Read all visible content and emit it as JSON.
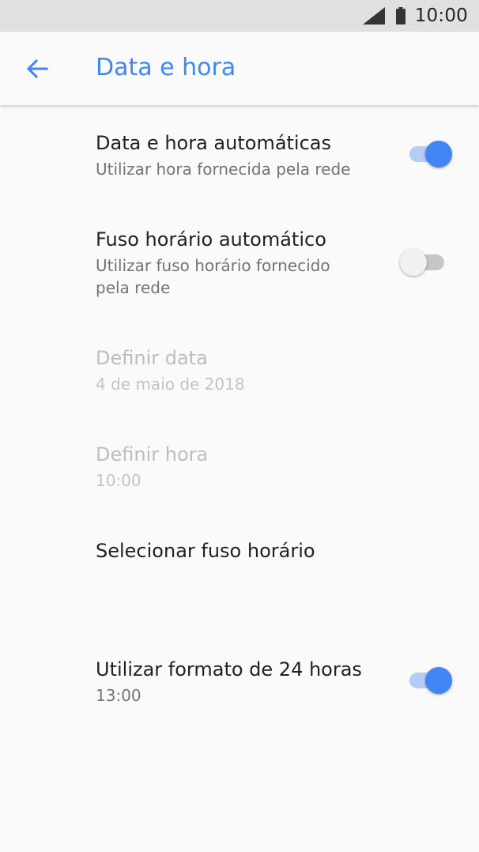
{
  "status_bar": {
    "time": "10:00",
    "icons": [
      "signal-icon",
      "battery-icon"
    ]
  },
  "app_bar": {
    "title": "Data e hora",
    "back_icon": "arrow-back-icon"
  },
  "colors": {
    "accent": "#4285f4",
    "title_text": "#212121",
    "summary_text": "#737373",
    "disabled_text": "#bdbdbd",
    "background": "#fafafa",
    "status_bar": "#e0e0e0"
  },
  "settings": {
    "auto_datetime": {
      "title": "Data e hora automáticas",
      "summary": "Utilizar hora fornecida pela rede",
      "enabled": true
    },
    "auto_timezone": {
      "title": "Fuso horário automático",
      "summary": "Utilizar fuso horário fornecido pela rede",
      "enabled": false
    },
    "set_date": {
      "title": "Definir data",
      "summary": "4 de maio de 2018"
    },
    "set_time": {
      "title": "Definir hora",
      "summary": "10:00"
    },
    "select_timezone": {
      "title": "Selecionar fuso horário"
    },
    "use_24h": {
      "title": "Utilizar formato de 24 horas",
      "summary": "13:00",
      "enabled": true
    }
  }
}
